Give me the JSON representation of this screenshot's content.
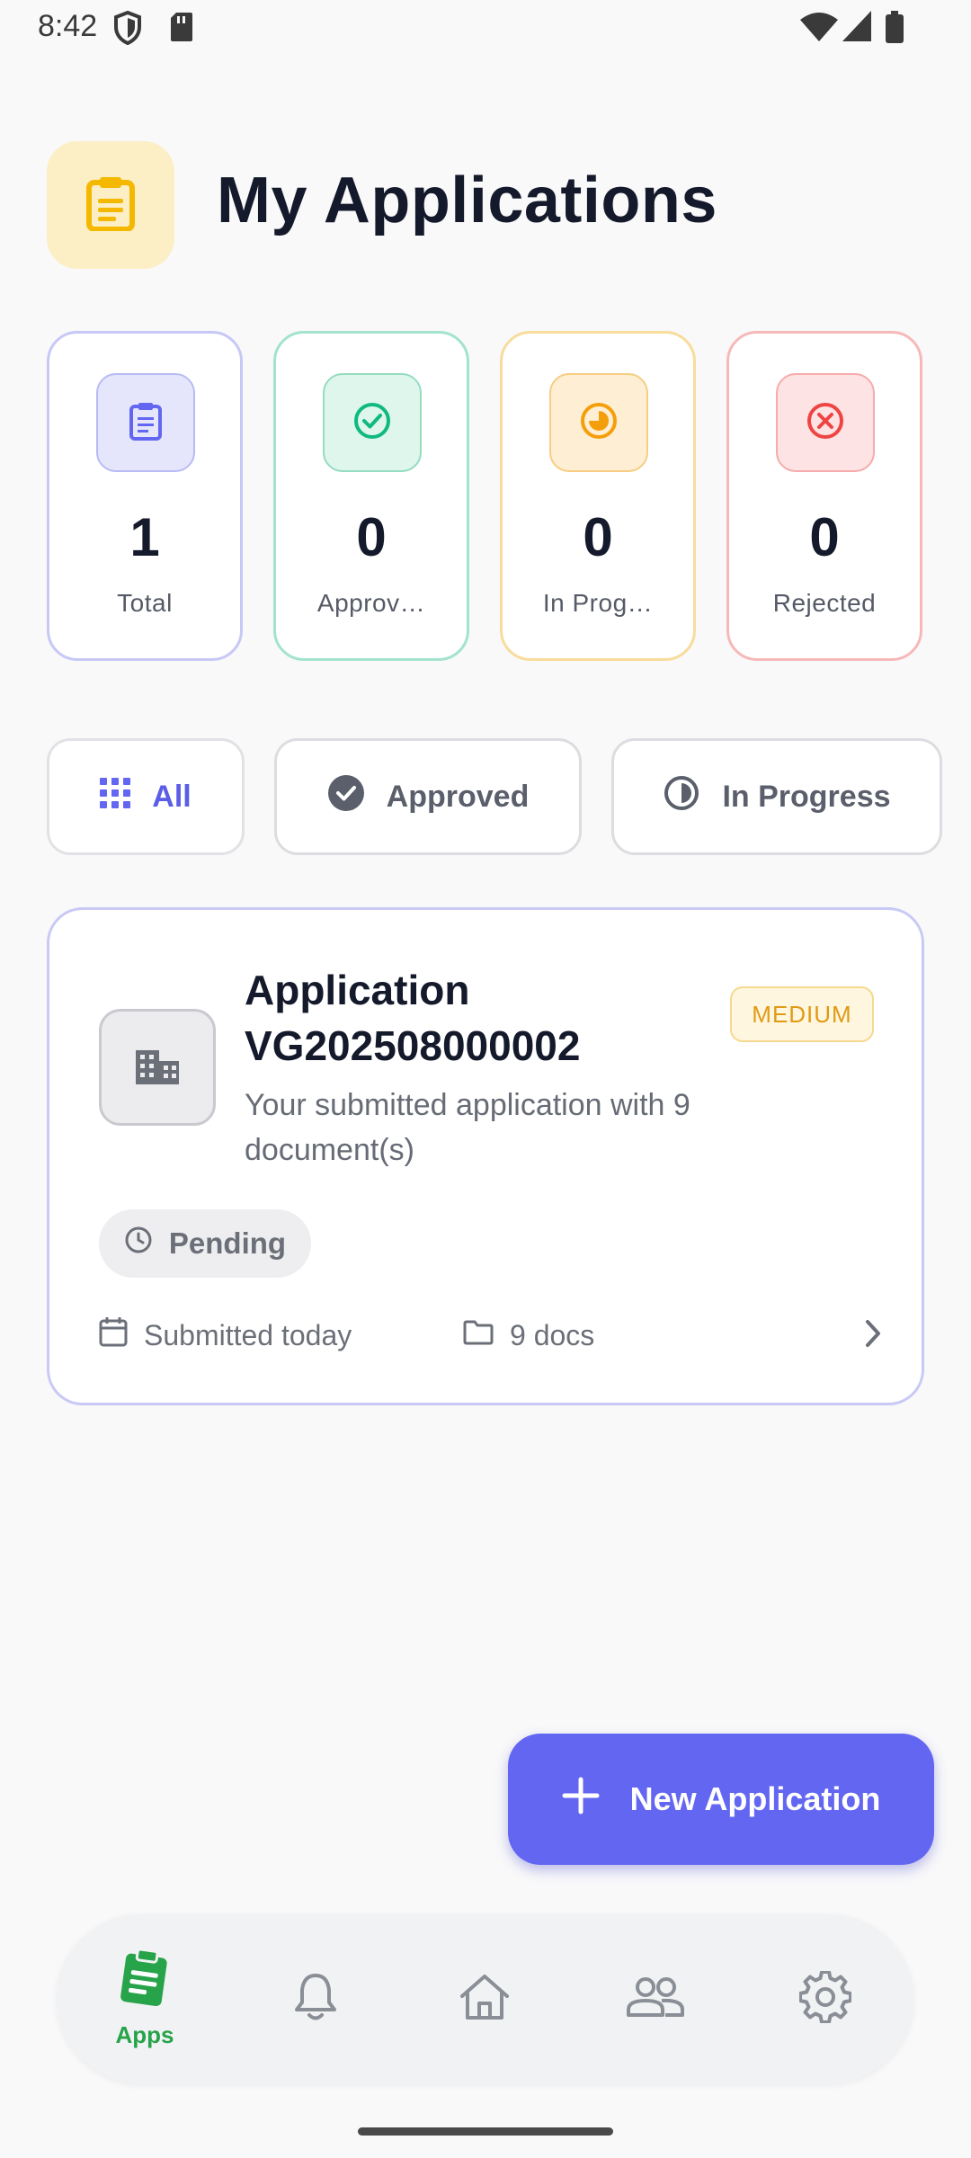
{
  "status_bar": {
    "time": "8:42"
  },
  "header": {
    "title": "My Applications",
    "icon": "clipboard-icon"
  },
  "stats": [
    {
      "value": "1",
      "label": "Total",
      "icon": "clipboard-icon",
      "color": "#6366f1"
    },
    {
      "value": "0",
      "label": "Approv…",
      "icon": "check-circle-icon",
      "color": "#10b981"
    },
    {
      "value": "0",
      "label": "In Prog…",
      "icon": "progress-icon",
      "color": "#f59e0b"
    },
    {
      "value": "0",
      "label": "Rejected",
      "icon": "x-circle-icon",
      "color": "#ef4444"
    }
  ],
  "filters": [
    {
      "label": "All",
      "icon": "grid-icon",
      "active": true
    },
    {
      "label": "Approved",
      "icon": "check-circle-filled-icon",
      "active": false
    },
    {
      "label": "In Progress",
      "icon": "progress-icon",
      "active": false
    }
  ],
  "application": {
    "title": "Application VG202508000002",
    "priority": "MEDIUM",
    "description": "Your submitted application with 9 document(s)",
    "status": "Pending",
    "submitted": "Submitted today",
    "docs": "9 docs"
  },
  "fab": {
    "label": "New Application"
  },
  "nav": {
    "active": "Apps",
    "items": [
      {
        "label": "Apps",
        "icon": "apps-clipboard-icon"
      },
      {
        "label": "",
        "icon": "bell-icon"
      },
      {
        "label": "",
        "icon": "home-icon"
      },
      {
        "label": "",
        "icon": "people-icon"
      },
      {
        "label": "",
        "icon": "gear-icon"
      }
    ]
  },
  "colors": {
    "accent": "#6366f1",
    "nav_active": "#27a34a",
    "priority_medium": "#e09a14"
  }
}
